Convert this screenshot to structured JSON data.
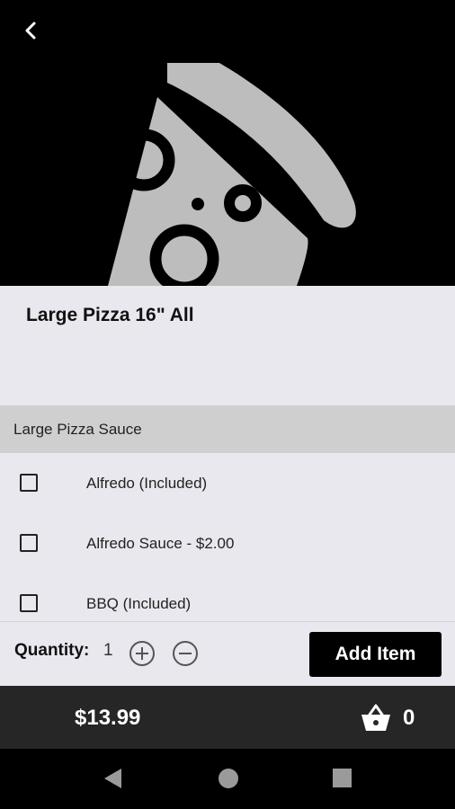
{
  "item": {
    "title": "Large Pizza 16\" All"
  },
  "section": {
    "title": "Large Pizza Sauce"
  },
  "options": [
    {
      "label": "Alfredo (Included)",
      "checked": false
    },
    {
      "label": "Alfredo Sauce - $2.00",
      "checked": false
    },
    {
      "label": "BBQ (Included)",
      "checked": false
    }
  ],
  "quantity": {
    "label": "Quantity:",
    "value": "1"
  },
  "actions": {
    "add_label": "Add Item"
  },
  "footer": {
    "price": "$13.99",
    "cart_count": "0"
  },
  "icons": {
    "back": "chevron-left-icon",
    "hero": "pizza-slice-icon",
    "increase": "plus-circle-icon",
    "decrease": "minus-circle-icon",
    "cart": "shopping-basket-icon",
    "nav_back": "triangle-back-icon",
    "nav_home": "circle-home-icon",
    "nav_recents": "square-recents-icon"
  },
  "colors": {
    "hero_bg": "#000000",
    "pizza": "#bdbdbd",
    "page_bg": "#e9e8ee",
    "section_bg": "#cfcfcf",
    "footer_bg": "#262626",
    "button_bg": "#000000"
  }
}
